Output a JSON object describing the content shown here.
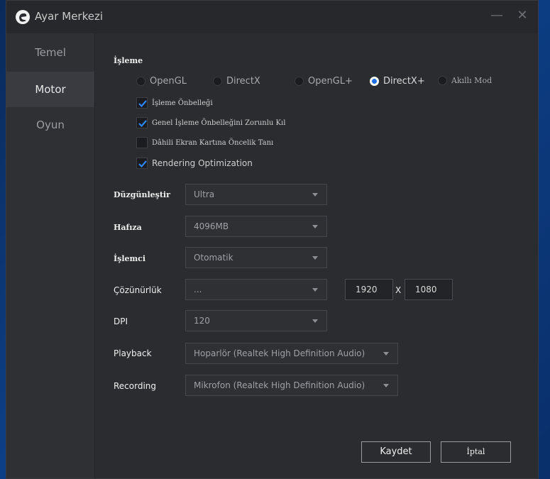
{
  "window": {
    "title": "Ayar Merkezi",
    "minimize_glyph": "—",
    "close_glyph": "✕"
  },
  "sidebar": {
    "items": [
      {
        "label": "Temel",
        "active": false
      },
      {
        "label": "Motor",
        "active": true
      },
      {
        "label": "Oyun",
        "active": false
      }
    ]
  },
  "render": {
    "title": "İşleme",
    "modes": [
      {
        "label": "OpenGL",
        "selected": false
      },
      {
        "label": "DirectX",
        "selected": false
      },
      {
        "label": "OpenGL+",
        "selected": false
      },
      {
        "label": "DirectX+",
        "selected": true
      },
      {
        "label": "Akıllı Mod",
        "selected": false
      }
    ],
    "options": [
      {
        "label": "İşleme Önbelleği",
        "checked": true
      },
      {
        "label": "Genel İşleme Önbelleğini Zorunlu Kıl",
        "checked": true
      },
      {
        "label": "Dâhili Ekran Kartına Öncelik Tanı",
        "checked": false
      },
      {
        "label": "Rendering Optimization",
        "checked": true
      }
    ]
  },
  "settings": {
    "antialias": {
      "label": "Düzgünleştir",
      "value": "Ultra"
    },
    "memory": {
      "label": "Hafıza",
      "value": "4096MB"
    },
    "cpu": {
      "label": "İşlemci",
      "value": "Otomatik"
    },
    "resolution": {
      "label": "Çözünürlük",
      "value": "...",
      "width": "1920",
      "separator": "X",
      "height": "1080"
    },
    "dpi": {
      "label": "DPI",
      "value": "120"
    },
    "playback": {
      "label": "Playback",
      "value": "Hoparlör (Realtek High Definition Audio)"
    },
    "recording": {
      "label": "Recording",
      "value": "Mikrofon (Realtek High Definition Audio)"
    }
  },
  "footer": {
    "save_label": "Kaydet",
    "cancel_label": "İptal"
  },
  "colors": {
    "accent": "#1e6fe6",
    "window_bg": "#2b2c30",
    "sidebar_bg": "#2f3034"
  }
}
